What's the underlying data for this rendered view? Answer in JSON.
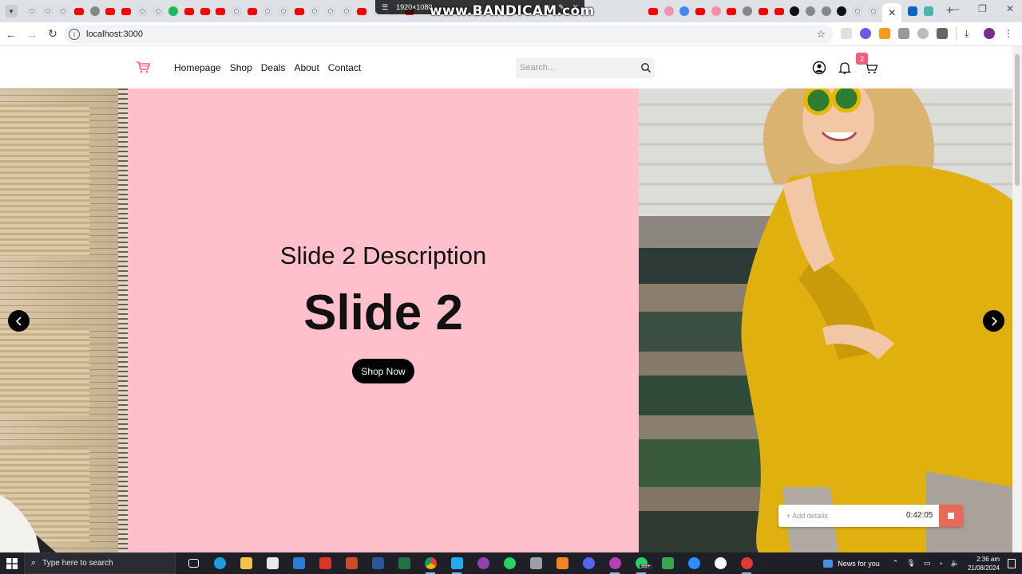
{
  "browser": {
    "url": "localhost:3000",
    "recorder_overlay": "www.BANDICAM.com",
    "recorder_resolution": "1920×1080"
  },
  "header": {
    "nav_items": [
      "Homepage",
      "Shop",
      "Deals",
      "About",
      "Contact"
    ],
    "search_placeholder": "Search...",
    "cart_count": "2",
    "accent_color": "#f35c7a"
  },
  "slider": {
    "current_slide": {
      "description": "Slide 2 Description",
      "title": "Slide 2",
      "button_label": "Shop Now",
      "background": "#ffc0cb"
    }
  },
  "recorder": {
    "details_placeholder": "+ Add details",
    "elapsed": "0:42:05"
  },
  "taskbar": {
    "search_placeholder": "Type here to search",
    "notification_badge": "99+",
    "news_label": "News for you",
    "time": "2:36 am",
    "date": "21/08/2024"
  }
}
